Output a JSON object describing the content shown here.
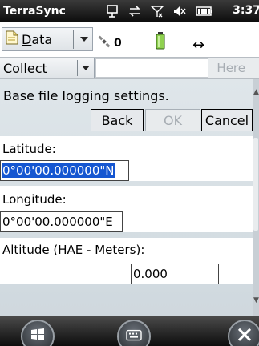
{
  "titlebar": {
    "app_name": "TerraSync",
    "time": "3:37",
    "icons": [
      "connection-icon",
      "data-sync-icon",
      "no-signal-icon",
      "volume-muted-icon",
      "battery-icon"
    ]
  },
  "toolbar": {
    "data_label_prefix": "",
    "data_label_underlined": "D",
    "data_label_rest": "ata",
    "satellite_count": "0",
    "icons": [
      "document-icon",
      "satellite-icon",
      "battery-icon",
      "connection-arrows-icon"
    ]
  },
  "collect_bar": {
    "collect_label_prefix": "Collec",
    "collect_label_underlined": "t",
    "collect_value": "",
    "here_label": "Here"
  },
  "form": {
    "heading": "Base file logging settings.",
    "back_label": "Back",
    "ok_label": "OK",
    "cancel_label": "Cancel",
    "latitude_label": "Latitude:",
    "latitude_value": "0°00'00.000000\"N",
    "longitude_label": "Longitude:",
    "longitude_value": "0°00'00.000000\"E",
    "altitude_label": "Altitude (HAE - Meters):",
    "altitude_value": "0.000"
  },
  "softkeys": {
    "icons": [
      "windows-start-icon",
      "keyboard-icon",
      "close-icon"
    ]
  },
  "colors": {
    "selection": "#1556d1",
    "panel": "#dfe6ea",
    "titlebar": "#0c0c0c"
  }
}
